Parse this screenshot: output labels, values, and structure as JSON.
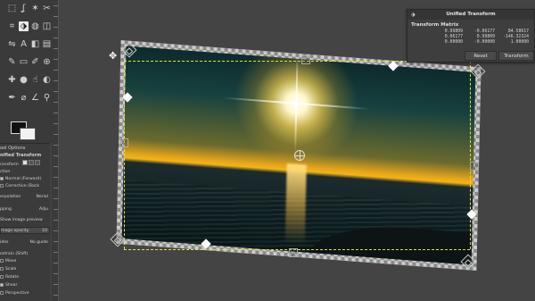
{
  "toolbox": {
    "tools": [
      {
        "icon": "rect-select-icon",
        "glyph": "⬚"
      },
      {
        "icon": "lasso-icon",
        "glyph": "ʆ"
      },
      {
        "icon": "fuzzy-select-icon",
        "glyph": "✶"
      },
      {
        "icon": "scissors-icon",
        "glyph": "✂"
      },
      {
        "icon": "crop-icon",
        "glyph": "⌗"
      },
      {
        "icon": "unified-transform-icon",
        "glyph": "⬗"
      },
      {
        "icon": "warp-icon",
        "glyph": "◍"
      },
      {
        "icon": "cage-icon",
        "glyph": "◫"
      },
      {
        "icon": "flip-icon",
        "glyph": "⇋"
      },
      {
        "icon": "text-icon",
        "glyph": "A"
      },
      {
        "icon": "bucket-icon",
        "glyph": "◧"
      },
      {
        "icon": "gradient-icon",
        "glyph": "▤"
      },
      {
        "icon": "paintbrush-icon",
        "glyph": "✎"
      },
      {
        "icon": "eraser-icon",
        "glyph": "▭"
      },
      {
        "icon": "airbrush-icon",
        "glyph": "✐"
      },
      {
        "icon": "clone-icon",
        "glyph": "⊕"
      },
      {
        "icon": "heal-icon",
        "glyph": "✚"
      },
      {
        "icon": "blur-icon",
        "glyph": "●"
      },
      {
        "icon": "smudge-icon",
        "glyph": "☝"
      },
      {
        "icon": "dodge-icon",
        "glyph": "◐"
      },
      {
        "icon": "path-icon",
        "glyph": "✒"
      },
      {
        "icon": "color-picker-icon",
        "glyph": "⌀"
      },
      {
        "icon": "measure-icon",
        "glyph": "∠"
      },
      {
        "icon": "zoom-icon",
        "glyph": "⚲"
      }
    ]
  },
  "tool_options": {
    "tab": "ool Options",
    "title": "nified Transform",
    "transform_label": "ransform",
    "direction_label": "ction",
    "normal_label": "Normal (Forward)",
    "corrective_label": "Corrective (Back",
    "interpolation_label": "erpolation",
    "interpolation_value": "Nerial",
    "clipping_label": "pping",
    "clipping_value": "Adju",
    "show_image_label": "Show image preview",
    "opacity_label": "mage opacity",
    "opacity_value": "10",
    "guides_label": "ides",
    "guides_value": "No guide",
    "constrain_label": "ostrain (Shift)",
    "move_label": "Move",
    "scale_label": "Scale",
    "rotate_label": "Rotate",
    "shear_label": "Shear",
    "perspective_label": "Perspective"
  },
  "dialog": {
    "title": "Unified Transform",
    "heading": "Transform Matrix",
    "matrix": [
      [
        "0.99809",
        "-0.06177",
        "84.58617"
      ],
      [
        "0.06177",
        "0.99809",
        "-146.32324"
      ],
      [
        "0.00000",
        "-0.00000",
        "1.00000"
      ]
    ],
    "reset_label": "Reset",
    "transform_label": "Transform"
  },
  "colors": {
    "selection_dash": "#e0e04a",
    "foreground": "#111111",
    "background": "#f2f2f2"
  }
}
